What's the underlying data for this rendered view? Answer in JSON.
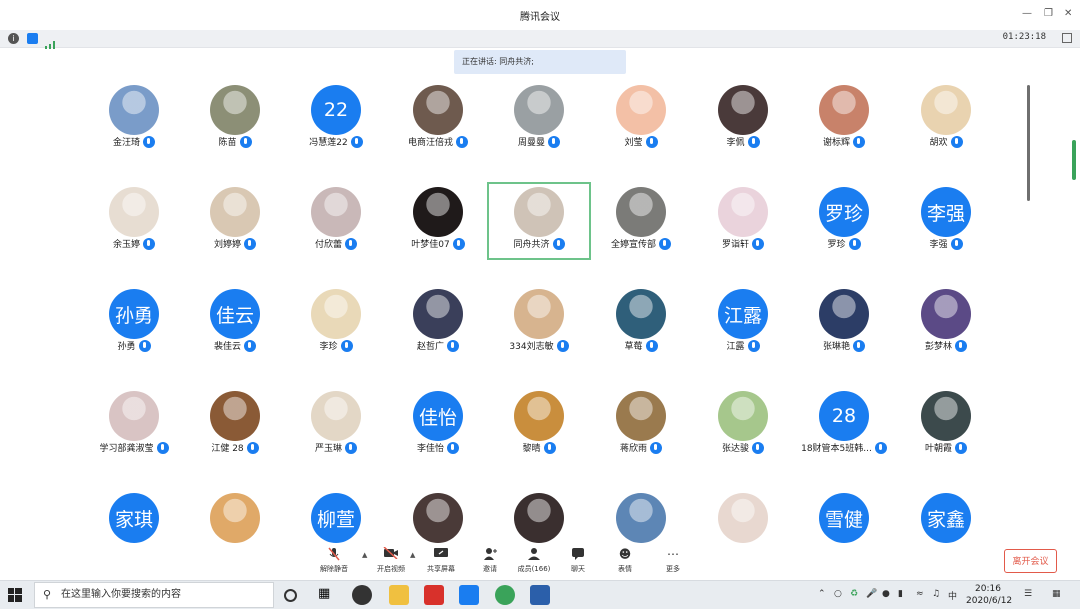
{
  "window": {
    "title": "腾讯会议",
    "timer": "01:23:18"
  },
  "speaking": {
    "label": "正在讲话: 同舟共济;"
  },
  "participants": [
    {
      "name": "金汪琦",
      "avatar": "photo",
      "color": "#7a9cc9",
      "highlight": false
    },
    {
      "name": "陈苗",
      "avatar": "photo",
      "color": "#8c8f76",
      "highlight": false
    },
    {
      "name": "冯慧莲22",
      "avatar": "text",
      "avatar_text": "22",
      "highlight": false
    },
    {
      "name": "电商汪倍戎",
      "avatar": "photo",
      "color": "#6e5a4e",
      "highlight": false
    },
    {
      "name": "周曼曼",
      "avatar": "photo",
      "color": "#9aa0a3",
      "highlight": false
    },
    {
      "name": "刘莹",
      "avatar": "photo",
      "color": "#f3c0a6",
      "highlight": false
    },
    {
      "name": "李佩",
      "avatar": "photo",
      "color": "#4a3a3a",
      "highlight": false
    },
    {
      "name": "谢标辉",
      "avatar": "photo",
      "color": "#c8826a",
      "highlight": false
    },
    {
      "name": "胡欢",
      "avatar": "photo",
      "color": "#e9d3b0",
      "highlight": false
    },
    {
      "name": "余玉婷",
      "avatar": "photo",
      "color": "#e7ddd2",
      "highlight": false
    },
    {
      "name": "刘婷婷",
      "avatar": "photo",
      "color": "#d9c8b3",
      "highlight": false
    },
    {
      "name": "付欣蕾",
      "avatar": "photo",
      "color": "#c9b8b8",
      "highlight": false
    },
    {
      "name": "叶梦佳07",
      "avatar": "photo",
      "color": "#1f1a1a",
      "highlight": false
    },
    {
      "name": "同舟共济",
      "avatar": "photo",
      "color": "#cfc3b7",
      "highlight": true
    },
    {
      "name": "全婷宣传部",
      "avatar": "photo",
      "color": "#7b7b78",
      "highlight": false
    },
    {
      "name": "罗诣轩",
      "avatar": "photo",
      "color": "#ead3dc",
      "highlight": false
    },
    {
      "name": "罗珍",
      "avatar": "text",
      "avatar_text": "罗珍",
      "highlight": false
    },
    {
      "name": "李强",
      "avatar": "text",
      "avatar_text": "李强",
      "highlight": false
    },
    {
      "name": "孙勇",
      "avatar": "text",
      "avatar_text": "孙勇",
      "highlight": false
    },
    {
      "name": "裴佳云",
      "avatar": "text",
      "avatar_text": "佳云",
      "highlight": false
    },
    {
      "name": "李珍",
      "avatar": "photo",
      "color": "#e9d9b8",
      "highlight": false
    },
    {
      "name": "赵哲广",
      "avatar": "photo",
      "color": "#3a3f5a",
      "highlight": false
    },
    {
      "name": "334刘志敏",
      "avatar": "photo",
      "color": "#d7b48f",
      "highlight": false
    },
    {
      "name": "草莓",
      "avatar": "photo",
      "color": "#2f5f7a",
      "highlight": false
    },
    {
      "name": "江露",
      "avatar": "text",
      "avatar_text": "江露",
      "highlight": false
    },
    {
      "name": "张琳艳",
      "avatar": "photo",
      "color": "#2c3d66",
      "highlight": false
    },
    {
      "name": "彭梦林",
      "avatar": "photo",
      "color": "#5b4a86",
      "highlight": false
    },
    {
      "name": "学习部龚淑莹",
      "avatar": "photo",
      "color": "#d9c4c4",
      "highlight": false
    },
    {
      "name": "江健 28",
      "avatar": "photo",
      "color": "#8a5a36",
      "highlight": false
    },
    {
      "name": "严玉琳",
      "avatar": "photo",
      "color": "#e3d7c6",
      "highlight": false
    },
    {
      "name": "李佳怡",
      "avatar": "text",
      "avatar_text": "佳怡",
      "highlight": false
    },
    {
      "name": "黎晴",
      "avatar": "photo",
      "color": "#c98e3d",
      "highlight": false
    },
    {
      "name": "蒋欣雨",
      "avatar": "photo",
      "color": "#9a7a4e",
      "highlight": false
    },
    {
      "name": "张达骏",
      "avatar": "photo",
      "color": "#a6c78c",
      "highlight": false
    },
    {
      "name": "18财管本5班韩...",
      "avatar": "text",
      "avatar_text": "28",
      "highlight": false
    },
    {
      "name": "叶朝霞",
      "avatar": "photo",
      "color": "#3c4a4c",
      "highlight": false
    },
    {
      "name": "",
      "avatar": "text",
      "avatar_text": "家琪",
      "highlight": false
    },
    {
      "name": "",
      "avatar": "photo",
      "color": "#e0a968",
      "highlight": false
    },
    {
      "name": "",
      "avatar": "text",
      "avatar_text": "柳萱",
      "highlight": false
    },
    {
      "name": "",
      "avatar": "photo",
      "color": "#4a3a38",
      "highlight": false
    },
    {
      "name": "",
      "avatar": "photo",
      "color": "#3a2f2f",
      "highlight": false
    },
    {
      "name": "",
      "avatar": "photo",
      "color": "#5d86b5",
      "highlight": false
    },
    {
      "name": "",
      "avatar": "photo",
      "color": "#e8d8d0",
      "highlight": false
    },
    {
      "name": "",
      "avatar": "text",
      "avatar_text": "雪健",
      "highlight": false
    },
    {
      "name": "",
      "avatar": "text",
      "avatar_text": "家鑫",
      "highlight": false
    }
  ],
  "toolbar": {
    "mute": "解除静音",
    "video": "开启视频",
    "share": "共享屏幕",
    "invite": "邀请",
    "members": "成员(166)",
    "chat": "聊天",
    "emoji": "表情",
    "more": "更多",
    "leave": "离开会议"
  },
  "taskbar": {
    "search_placeholder": "在这里输入你要搜索的内容",
    "time": "20:16",
    "date": "2020/6/12",
    "ime": "中"
  },
  "icons": {
    "info": "info-icon",
    "shield": "shield-icon",
    "signal": "signal-icon"
  }
}
